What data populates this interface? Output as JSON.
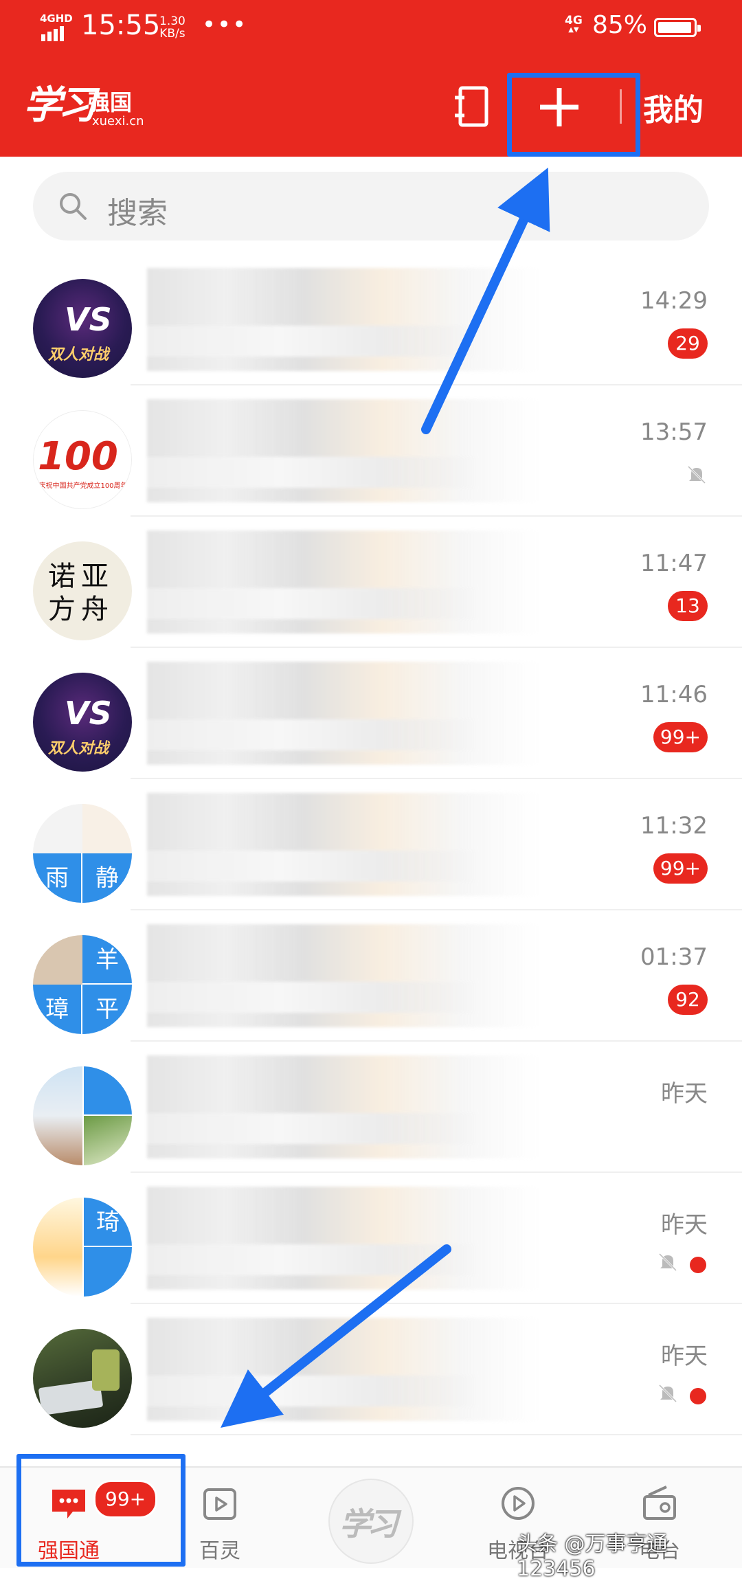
{
  "status_bar": {
    "network_label": "4GHD",
    "time": "15:55",
    "speed_value": "1.30",
    "speed_unit": "KB/s",
    "more": "•••",
    "cell_label": "4G",
    "battery_percent": "85%",
    "battery_level": 0.85
  },
  "header": {
    "logo_script": "学习",
    "logo_name": "强国",
    "logo_url": "xuexi.cn",
    "contacts_icon": "address-book-icon",
    "add_icon": "plus-icon",
    "mine_label": "我的",
    "accent_color": "#e8281f",
    "highlight_color": "#1d6ff2"
  },
  "search": {
    "placeholder": "搜索",
    "icon": "search-icon"
  },
  "conversations": [
    {
      "avatar": "双人对战",
      "time": "14:29",
      "badge": "29",
      "muted": false,
      "dot": false
    },
    {
      "avatar": "100",
      "avatar_caption": "庆祝中国共产党成立100周年 the 100th Anniversary of the Founding of The Communist Party of China",
      "time": "13:57",
      "badge": "",
      "muted": true,
      "dot": false
    },
    {
      "avatar": "诺亚方舟",
      "time": "11:47",
      "badge": "13",
      "muted": false,
      "dot": false
    },
    {
      "avatar": "双人对战",
      "time": "11:46",
      "badge": "99+",
      "muted": false,
      "dot": false
    },
    {
      "avatar": "雨静",
      "time": "11:32",
      "badge": "99+",
      "muted": false,
      "dot": false
    },
    {
      "avatar": "羊璋平",
      "time": "01:37",
      "badge": "92",
      "muted": false,
      "dot": false
    },
    {
      "avatar": "photo",
      "time": "昨天",
      "badge": "",
      "muted": false,
      "dot": false
    },
    {
      "avatar": "琦",
      "time": "昨天",
      "badge": "",
      "muted": true,
      "dot": true
    },
    {
      "avatar": "photo",
      "time": "昨天",
      "badge": "",
      "muted": true,
      "dot": true
    }
  ],
  "avatars": {
    "vs_text": "VS",
    "battle_text": "双人对战",
    "hundred": "100",
    "hundred_caption": "庆祝中国共产党成立100周年",
    "noah": [
      "诺",
      "亚",
      "方",
      "舟"
    ],
    "yujing": [
      "雨",
      "静"
    ],
    "yang": [
      "羊",
      "璋",
      "平"
    ],
    "qi": "琦"
  },
  "bottom_nav": {
    "items": [
      {
        "label": "强国通",
        "icon": "chat-bubble-icon",
        "badge": "99+",
        "active": true
      },
      {
        "label": "百灵",
        "icon": "video-play-icon",
        "active": false
      },
      {
        "label": "学习",
        "icon": "xuexi-logo-icon",
        "active": false
      },
      {
        "label": "电视台",
        "icon": "tv-play-icon",
        "active": false
      },
      {
        "label": "电台",
        "icon": "radio-icon",
        "active": false
      }
    ]
  },
  "watermark": "头条 @万事亨通123456"
}
